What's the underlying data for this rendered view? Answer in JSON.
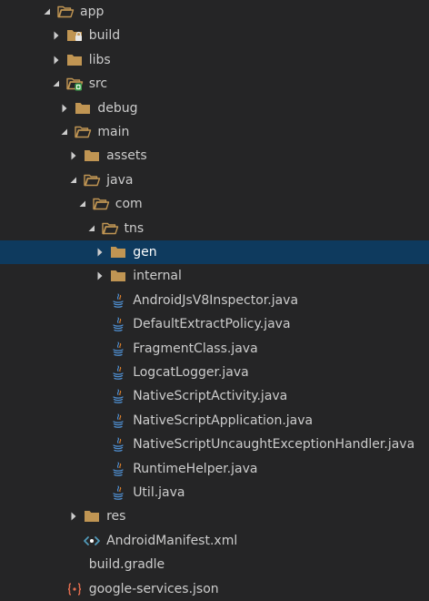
{
  "explorer": {
    "rows": [
      {
        "label": "app",
        "kind": "folder-open",
        "expanded": true,
        "depth": 0
      },
      {
        "label": "build",
        "kind": "folder-badge-lock",
        "expanded": false,
        "depth": 1
      },
      {
        "label": "libs",
        "kind": "folder",
        "expanded": false,
        "depth": 1
      },
      {
        "label": "src",
        "kind": "folder-open-badge-green",
        "expanded": true,
        "depth": 1
      },
      {
        "label": "debug",
        "kind": "folder",
        "expanded": false,
        "depth": 2
      },
      {
        "label": "main",
        "kind": "folder-open",
        "expanded": true,
        "depth": 2
      },
      {
        "label": "assets",
        "kind": "folder",
        "expanded": false,
        "depth": 3
      },
      {
        "label": "java",
        "kind": "folder-open",
        "expanded": true,
        "depth": 3
      },
      {
        "label": "com",
        "kind": "folder-open",
        "expanded": true,
        "depth": 4
      },
      {
        "label": "tns",
        "kind": "folder-open",
        "expanded": true,
        "depth": 5
      },
      {
        "label": "gen",
        "kind": "folder",
        "expanded": false,
        "depth": 6,
        "selected": true
      },
      {
        "label": "internal",
        "kind": "folder",
        "expanded": false,
        "depth": 6
      },
      {
        "label": "AndroidJsV8Inspector.java",
        "kind": "java-file",
        "depth": 6
      },
      {
        "label": "DefaultExtractPolicy.java",
        "kind": "java-file",
        "depth": 6
      },
      {
        "label": "FragmentClass.java",
        "kind": "java-file",
        "depth": 6
      },
      {
        "label": "LogcatLogger.java",
        "kind": "java-file",
        "depth": 6
      },
      {
        "label": "NativeScriptActivity.java",
        "kind": "java-file",
        "depth": 6
      },
      {
        "label": "NativeScriptApplication.java",
        "kind": "java-file",
        "depth": 6
      },
      {
        "label": "NativeScriptUncaughtExceptionHandler.java",
        "kind": "java-file",
        "depth": 6
      },
      {
        "label": "RuntimeHelper.java",
        "kind": "java-file",
        "depth": 6
      },
      {
        "label": "Util.java",
        "kind": "java-file",
        "depth": 6
      },
      {
        "label": "res",
        "kind": "folder",
        "expanded": false,
        "depth": 3
      },
      {
        "label": "AndroidManifest.xml",
        "kind": "xml-file",
        "depth": 3
      },
      {
        "label": "build.gradle",
        "kind": "file",
        "depth": 1
      },
      {
        "label": "google-services.json",
        "kind": "json-file",
        "depth": 1
      }
    ]
  },
  "colors": {
    "background": "#252526",
    "selection": "#0e3a5e",
    "folder": "#c09553",
    "text": "#cccccc",
    "java": "#4f8fd1",
    "xml": "#519aba",
    "json": "#e06c4e"
  }
}
